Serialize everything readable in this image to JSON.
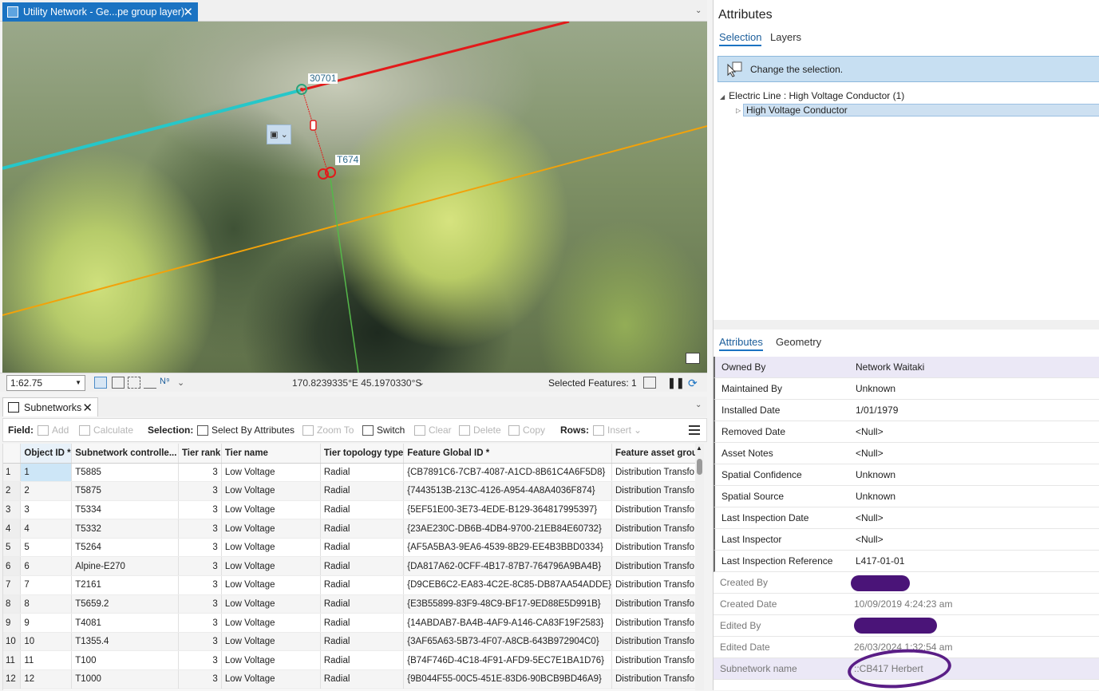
{
  "map_view": {
    "tab_title": "Utility Network - Ge...pe group layer)",
    "labels": {
      "junction_top": "30701",
      "junction_bottom": "T674"
    },
    "scale": "1:62.75",
    "coordinates": "170.8239335°E 45.1970330°S",
    "selected_features": "Selected Features: 1",
    "colors": {
      "red_line": "#e21a1a",
      "cyan_line": "#26c7c9",
      "orange_line": "#f2a20a",
      "green_line": "#55b84a"
    }
  },
  "table_view": {
    "tab_title": "Subnetworks",
    "toolbar": {
      "field_label": "Field:",
      "add": "Add",
      "calculate": "Calculate",
      "selection_label": "Selection:",
      "select_by_attributes": "Select By Attributes",
      "zoom_to": "Zoom To",
      "switch": "Switch",
      "clear": "Clear",
      "delete": "Delete",
      "copy": "Copy",
      "rows_label": "Rows:",
      "insert": "Insert"
    },
    "columns": [
      "Object ID *",
      "Subnetwork controlle...",
      "Tier rank",
      "Tier name",
      "Tier topology type",
      "Feature Global ID *",
      "Feature asset group"
    ],
    "rows": [
      [
        "1",
        "1",
        "T5885",
        "3",
        "Low Voltage",
        "Radial",
        "{CB7891C6-7CB7-4087-A1CD-8B61C4A6F5D8}",
        "Distribution Transfo"
      ],
      [
        "2",
        "2",
        "T5875",
        "3",
        "Low Voltage",
        "Radial",
        "{7443513B-213C-4126-A954-4A8A4036F874}",
        "Distribution Transfo"
      ],
      [
        "3",
        "3",
        "T5334",
        "3",
        "Low Voltage",
        "Radial",
        "{5EF51E00-3E73-4EDE-B129-364817995397}",
        "Distribution Transfo"
      ],
      [
        "4",
        "4",
        "T5332",
        "3",
        "Low Voltage",
        "Radial",
        "{23AE230C-DB6B-4DB4-9700-21EB84E60732}",
        "Distribution Transfo"
      ],
      [
        "5",
        "5",
        "T5264",
        "3",
        "Low Voltage",
        "Radial",
        "{AF5A5BA3-9EA6-4539-8B29-EE4B3BBD0334}",
        "Distribution Transfo"
      ],
      [
        "6",
        "6",
        "Alpine-E270",
        "3",
        "Low Voltage",
        "Radial",
        "{DA817A62-0CFF-4B17-87B7-764796A9BA4B}",
        "Distribution Transfo"
      ],
      [
        "7",
        "7",
        "T2161",
        "3",
        "Low Voltage",
        "Radial",
        "{D9CEB6C2-EA83-4C2E-8C85-DB87AA54ADDE}",
        "Distribution Transfo"
      ],
      [
        "8",
        "8",
        "T5659.2",
        "3",
        "Low Voltage",
        "Radial",
        "{E3B55899-83F9-48C9-BF17-9ED88E5D991B}",
        "Distribution Transfo"
      ],
      [
        "9",
        "9",
        "T4081",
        "3",
        "Low Voltage",
        "Radial",
        "{14ABDAB7-BA4B-4AF9-A146-CA83F19F2583}",
        "Distribution Transfo"
      ],
      [
        "10",
        "10",
        "T1355.4",
        "3",
        "Low Voltage",
        "Radial",
        "{3AF65A63-5B73-4F07-A8CB-643B972904C0}",
        "Distribution Transfo"
      ],
      [
        "11",
        "11",
        "T100",
        "3",
        "Low Voltage",
        "Radial",
        "{B74F746D-4C18-4F91-AFD9-5EC7E1BA1D76}",
        "Distribution Transfo"
      ],
      [
        "12",
        "12",
        "T1000",
        "3",
        "Low Voltage",
        "Radial",
        "{9B044F55-00C5-451E-83D6-90BCB9BD46A9}",
        "Distribution Transfo"
      ]
    ]
  },
  "attributes_pane": {
    "title": "Attributes",
    "tabs": [
      "Selection",
      "Layers"
    ],
    "notice": "Change the selection.",
    "tree_parent": "Electric Line : High Voltage Conductor (1)",
    "tree_child": "High Voltage Conductor",
    "detail_tabs": [
      "Attributes",
      "Geometry"
    ],
    "fields": [
      {
        "label": "Owned By",
        "value": "Network Waitaki"
      },
      {
        "label": "Maintained By",
        "value": "Unknown"
      },
      {
        "label": "Installed Date",
        "value": "1/01/1979"
      },
      {
        "label": "Removed Date",
        "value": "<Null>"
      },
      {
        "label": "Asset Notes",
        "value": "<Null>"
      },
      {
        "label": "Spatial Confidence",
        "value": "Unknown"
      },
      {
        "label": "Spatial Source",
        "value": "Unknown"
      },
      {
        "label": "Last Inspection Date",
        "value": "<Null>"
      },
      {
        "label": "Last Inspector",
        "value": "<Null>"
      },
      {
        "label": "Last Inspection Reference",
        "value": "L417-01-01"
      },
      {
        "label": "Created By",
        "value": ""
      },
      {
        "label": "Created Date",
        "value": "10/09/2019 4:24:23 am"
      },
      {
        "label": "Edited By",
        "value": ""
      },
      {
        "label": "Edited Date",
        "value": "26/03/2024 1:32:54 am"
      },
      {
        "label": "Subnetwork name",
        "value": "::CB417 Herbert"
      }
    ],
    "redaction_color": "#4a1478"
  }
}
